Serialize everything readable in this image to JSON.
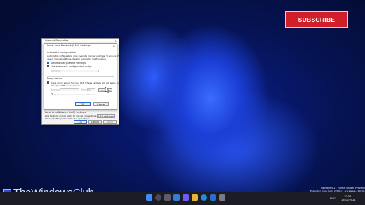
{
  "overlay": {
    "subscribe_label": "SUBSCRIBE"
  },
  "outer_dialog": {
    "title": "Internet Properties",
    "lan_heading": "Local Area Network (LAN) settings",
    "lan_desc_1": "LAN Settings do not apply to dial-up connections.",
    "lan_desc_2": "Choose Settings above for dial-up settings.",
    "lan_button": "LAN settings",
    "ok": "OK",
    "cancel": "Cancel",
    "apply": "Apply"
  },
  "lan_dialog": {
    "title": "Local Area Network (LAN) Settings",
    "auto_heading": "Automatic configuration",
    "auto_desc_1": "Automatic configuration may override manual settings. To ensure the",
    "auto_desc_2": "use of manual settings, disable automatic configuration.",
    "auto_detect_label": "Automatically detect settings",
    "auto_detect_checked": true,
    "use_script_label": "Use automatic configuration script",
    "use_script_checked": false,
    "address_label": "Address",
    "proxy_heading": "Proxy server",
    "proxy_desc_1": "Use a proxy server for your LAN (These settings will not apply to",
    "proxy_desc_2": "dial-up or VPN connections).",
    "proxy_checked": false,
    "proxy_address_label": "Address:",
    "proxy_port_label": "Port:",
    "proxy_port_value": "80",
    "advanced_label": "Advanced",
    "bypass_label": "Bypass proxy server for local addresses",
    "ok": "OK",
    "cancel": "Cancel"
  },
  "watermark": {
    "logo_text": "TheWindowsClub",
    "line1": "Windows 11 Home Insider Preview",
    "line2": "Evaluation copy. Build 22000.rs_prerelease.211016-1409"
  },
  "tray": {
    "time": "10:58",
    "date": "19/10/2021",
    "lang": "ENG"
  },
  "colors": {
    "subscribe_bg": "#d11f2a",
    "taskbar": "#1c1c24",
    "accent": "#1a64c8"
  }
}
